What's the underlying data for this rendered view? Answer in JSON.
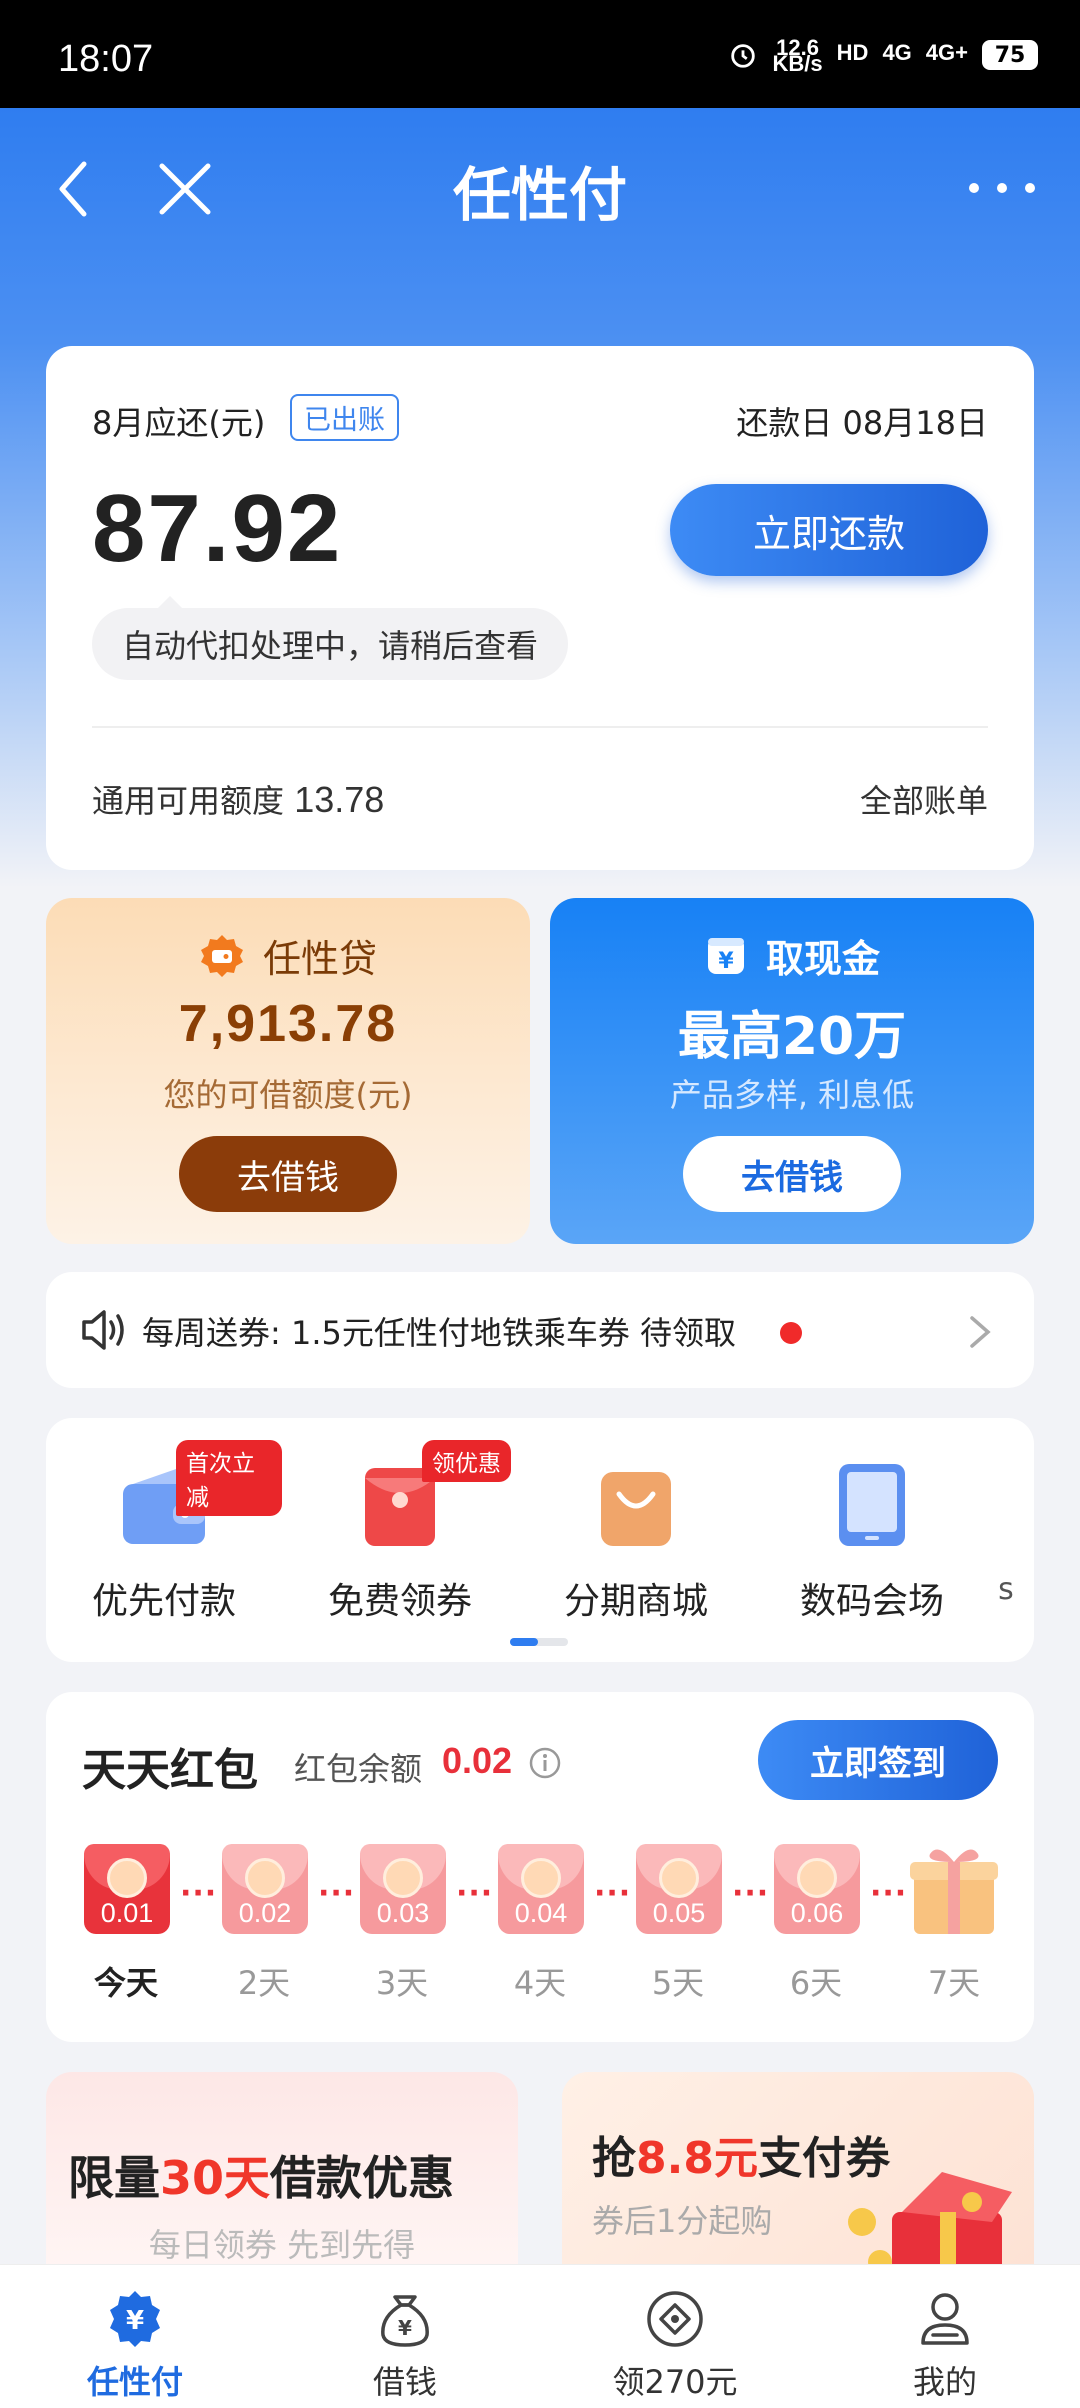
{
  "status_bar": {
    "time": "18:07",
    "net_speed_value": "12.6",
    "net_speed_unit": "KB/s",
    "hd": "HD",
    "net1": "4G",
    "net2": "4G+",
    "battery": "75"
  },
  "nav": {
    "title": "任性付"
  },
  "bill": {
    "month_label": "8月应还(元)",
    "status_badge": "已出账",
    "due_date": "还款日 08月18日",
    "amount": "87.92",
    "repay_button": "立即还款",
    "tip": "自动代扣处理中，请稍后查看",
    "limit_label": "通用可用额度",
    "limit_value": "13.78",
    "all_bills": "全部账单"
  },
  "loan_promo": {
    "title": "任性贷",
    "value": "7,913.78",
    "subtitle": "您的可借额度(元)",
    "button": "去借钱"
  },
  "cash_promo": {
    "title": "取现金",
    "value": "最高20万",
    "subtitle": "产品多样, 利息低",
    "button": "去借钱"
  },
  "notice": {
    "text": "每周送券: 1.5元任性付地铁乘车券 待领取"
  },
  "menu": {
    "items": [
      {
        "label": "优先付款",
        "tag": "首次立减",
        "icon": "wallet-icon"
      },
      {
        "label": "免费领券",
        "tag": "领优惠",
        "icon": "coupon-envelope-icon"
      },
      {
        "label": "分期商城",
        "tag": "",
        "icon": "shopping-bag-icon"
      },
      {
        "label": "数码会场",
        "tag": "",
        "icon": "tablet-icon"
      }
    ],
    "partial_label": "s"
  },
  "redpack": {
    "title": "天天红包",
    "balance_label": "红包余额",
    "balance": "0.02",
    "sign_button": "立即签到",
    "days": [
      {
        "amount": "0.01",
        "label": "今天"
      },
      {
        "amount": "0.02",
        "label": "2天"
      },
      {
        "amount": "0.03",
        "label": "3天"
      },
      {
        "amount": "0.04",
        "label": "4天"
      },
      {
        "amount": "0.05",
        "label": "5天"
      },
      {
        "amount": "0.06",
        "label": "6天"
      },
      {
        "amount": "",
        "label": "7天"
      }
    ],
    "dots": "···"
  },
  "banners": {
    "left": {
      "title_pre": "限量",
      "title_highlight": "30天",
      "title_post": "借款优惠",
      "subtitle": "每日领券 先到先得"
    },
    "right": {
      "title_pre": "抢",
      "title_highlight": "8.8元",
      "title_post": "支付券",
      "subtitle": "券后1分起购"
    }
  },
  "tabs": [
    {
      "label": "任性付",
      "icon": "yuan-shield-icon",
      "active": true
    },
    {
      "label": "借钱",
      "icon": "money-bag-icon",
      "active": false
    },
    {
      "label": "领270元",
      "icon": "diamond-coin-icon",
      "active": false
    },
    {
      "label": "我的",
      "icon": "person-icon",
      "active": false
    }
  ],
  "colors": {
    "primary": "#1f6be0",
    "accent_red": "#e8303a",
    "loan_brown": "#8b3c0a"
  }
}
